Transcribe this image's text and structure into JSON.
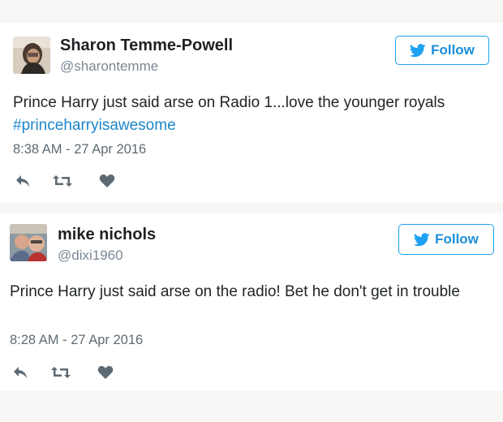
{
  "tweets": [
    {
      "display_name": "Sharon Temme-Powell",
      "handle": "@sharontemme",
      "follow_label": "Follow",
      "text": "Prince Harry just said arse on Radio 1...love the younger royals",
      "hashtag": "#princeharryisawesome",
      "timestamp": "8:38 AM - 27 Apr 2016",
      "icons": [
        "twitter-bird-icon",
        "reply-icon",
        "retweet-icon",
        "like-heart-icon"
      ]
    },
    {
      "display_name": "mike nichols",
      "handle": "@dixi1960",
      "follow_label": "Follow",
      "text": "Prince Harry just said arse on the radio! Bet he don't get in trouble",
      "timestamp": "8:28 AM - 27 Apr 2016",
      "icons": [
        "twitter-bird-icon",
        "reply-icon",
        "retweet-icon",
        "like-heart-icon"
      ]
    }
  ],
  "colors": {
    "accent": "#1da1f2",
    "hashtag": "#1b86c9",
    "muted": "#7b8793",
    "icon": "#5e6a73",
    "page_background": "#f7f6f5"
  }
}
